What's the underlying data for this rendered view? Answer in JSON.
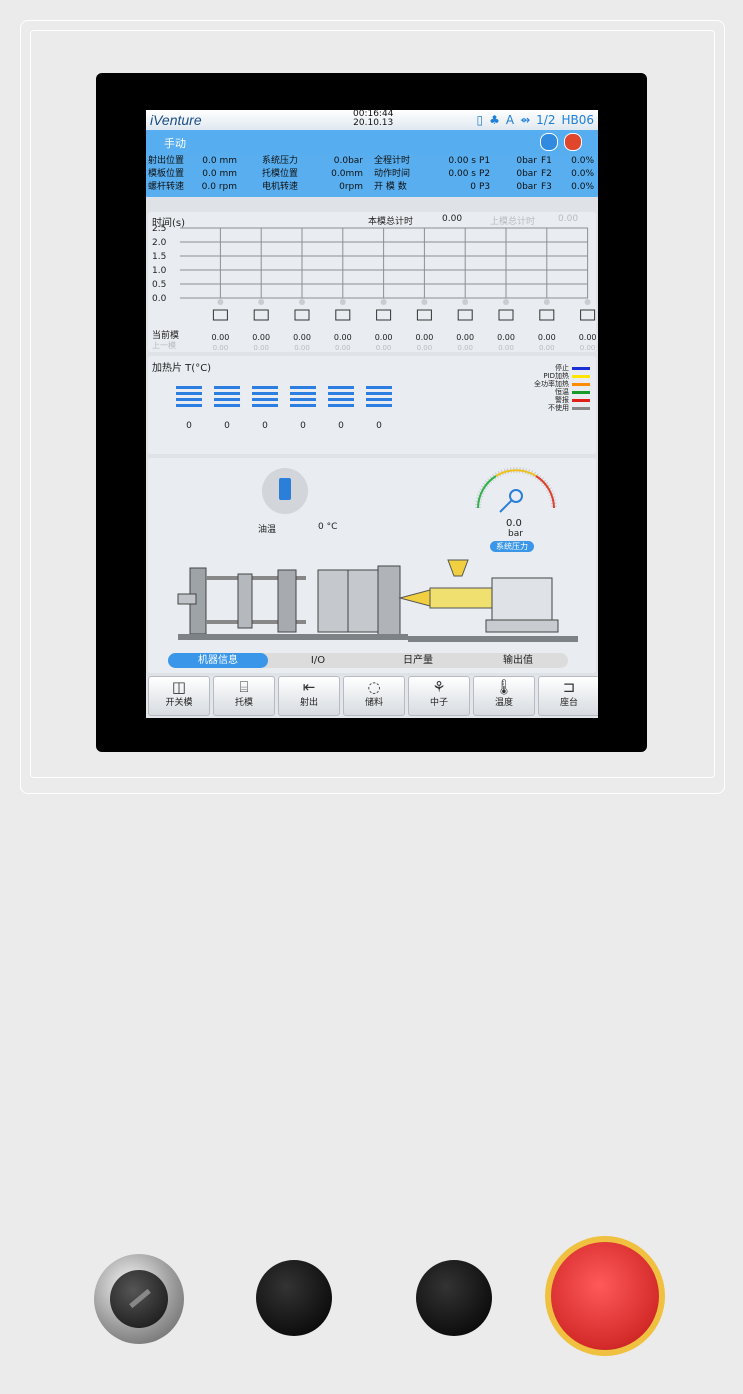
{
  "topbar": {
    "logo": "iVenture",
    "time": "00:16:44",
    "date": "20.10.13",
    "mode_letter": "A",
    "page": "1/2",
    "machine": "HB06"
  },
  "mode": "手动",
  "status": {
    "rows": [
      [
        {
          "label": "射出位置",
          "value": "0.0 mm"
        },
        {
          "label": "系统压力",
          "value": "0.0bar"
        },
        {
          "label": "全程计时",
          "value": "0.00 s"
        },
        {
          "label": "P1",
          "value": "0bar"
        },
        {
          "label": "F1",
          "value": "0.0%"
        }
      ],
      [
        {
          "label": "模板位置",
          "value": "0.0 mm"
        },
        {
          "label": "托模位置",
          "value": "0.0mm"
        },
        {
          "label": "动作时间",
          "value": "0.00 s"
        },
        {
          "label": "P2",
          "value": "0bar"
        },
        {
          "label": "F2",
          "value": "0.0%"
        }
      ],
      [
        {
          "label": "螺杆转速",
          "value": "0.0 rpm"
        },
        {
          "label": "电机转速",
          "value": "0rpm"
        },
        {
          "label": "开 模 数",
          "value": "0"
        },
        {
          "label": "P3",
          "value": "0bar"
        },
        {
          "label": "F3",
          "value": "0.0%"
        }
      ]
    ]
  },
  "timing": {
    "title": "时间(s)",
    "total_label": "本模总计时",
    "total_value": "0.00",
    "prev_total_label": "上模总计时",
    "prev_total_value": "0.00",
    "current_label": "当前模",
    "prev_label": "上一模",
    "chart_data": {
      "type": "bar",
      "categories": [
        "开关模",
        "托模",
        "射出1",
        "射出2",
        "射出3",
        "射出4",
        "座台",
        "中子",
        "开关模2",
        "托模2"
      ],
      "values": [
        0,
        0,
        0,
        0,
        0,
        0,
        0,
        0,
        0,
        0
      ],
      "prev_values": [
        0,
        0,
        0,
        0,
        0,
        0,
        0,
        0,
        0,
        0
      ],
      "ylim": [
        0,
        2.5
      ],
      "yticks": [
        "2.5",
        "2.0",
        "1.5",
        "1.0",
        "0.5",
        "0.0"
      ]
    },
    "current_values": [
      "0.00",
      "0.00",
      "0.00",
      "0.00",
      "0.00",
      "0.00",
      "0.00",
      "0.00",
      "0.00",
      "0.00"
    ],
    "prev_values": [
      "0.00",
      "0.00",
      "0.00",
      "0.00",
      "0.00",
      "0.00",
      "0.00",
      "0.00",
      "0.00",
      "0.00"
    ]
  },
  "heaters": {
    "title": "加热片 T(°C)",
    "values": [
      "0",
      "0",
      "0",
      "0",
      "0",
      "0"
    ],
    "legend": [
      {
        "label": "停止",
        "color": "#1a2fd6"
      },
      {
        "label": "PID加热",
        "color": "#ffe600"
      },
      {
        "label": "全功率加热",
        "color": "#ff8c00"
      },
      {
        "label": "恒温",
        "color": "#1a9a2a"
      },
      {
        "label": "警报",
        "color": "#e0201a"
      },
      {
        "label": "不使用",
        "color": "#888888"
      }
    ]
  },
  "machine": {
    "oil_label": "油温",
    "oil_value": "0 °C",
    "pressure_value": "0.0",
    "pressure_unit": "bar",
    "pressure_label": "系统压力"
  },
  "tabs": [
    {
      "label": "机器信息",
      "active": true
    },
    {
      "label": "I/O",
      "active": false
    },
    {
      "label": "日产量",
      "active": false
    },
    {
      "label": "输出值",
      "active": false
    }
  ],
  "toolbar": [
    {
      "label": "开关模",
      "icon": "mold-open-close-icon",
      "glyph": "◫"
    },
    {
      "label": "托模",
      "icon": "ejector-icon",
      "glyph": "⌸"
    },
    {
      "label": "射出",
      "icon": "injection-icon",
      "glyph": "⇤"
    },
    {
      "label": "储料",
      "icon": "charging-icon",
      "glyph": "◌"
    },
    {
      "label": "中子",
      "icon": "core-pull-icon",
      "glyph": "⚘"
    },
    {
      "label": "温度",
      "icon": "thermometer-icon",
      "glyph": "🌡"
    },
    {
      "label": "座台",
      "icon": "carriage-icon",
      "glyph": "⊐"
    }
  ],
  "colors": {
    "accent": "#3a96e8",
    "status_bg": "#58aeef",
    "estop": "#e8383c"
  }
}
